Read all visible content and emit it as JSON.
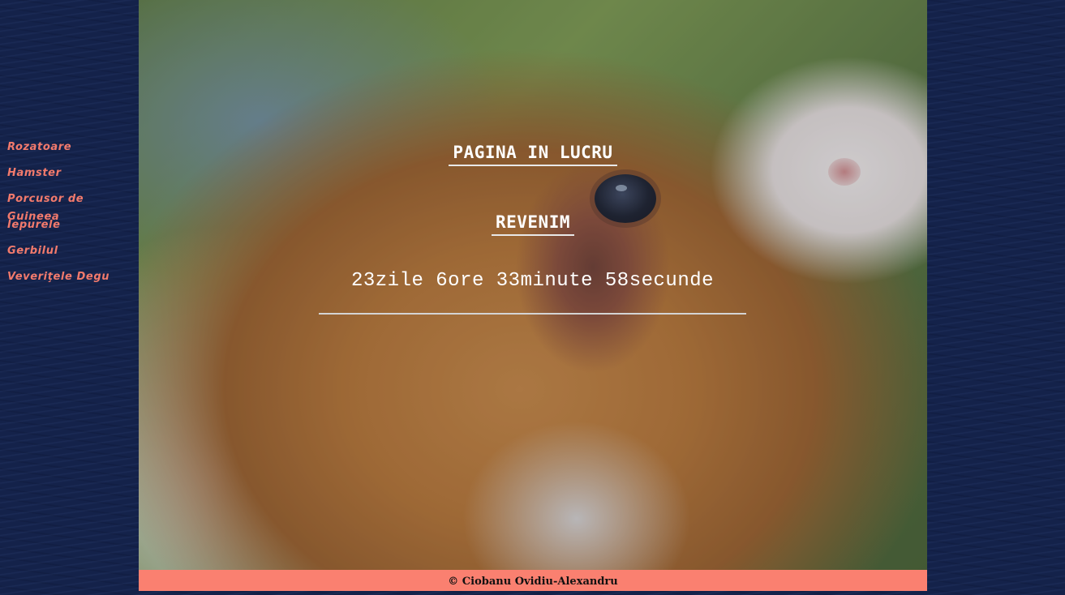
{
  "sidebar": {
    "items": [
      {
        "label": "Rozatoare"
      },
      {
        "label": "Hamster"
      },
      {
        "label": "Porcusor de Guineea"
      },
      {
        "label": "Iepurele"
      },
      {
        "label": "Gerbilul"
      },
      {
        "label": "Veveriţele Degu"
      }
    ]
  },
  "main": {
    "background_image": "guinea-pig-photo",
    "title": "PAGINA IN LUCRU",
    "subtitle": "REVENIM",
    "countdown": "23zile 6ore 33minute 58secunde"
  },
  "footer": {
    "text": "© Ciobanu Ovidiu-Alexandru"
  },
  "colors": {
    "background": "#14224a",
    "nav_link": "#f27a6c",
    "footer_bg": "#fa8070",
    "heading_text": "#ffffff"
  }
}
